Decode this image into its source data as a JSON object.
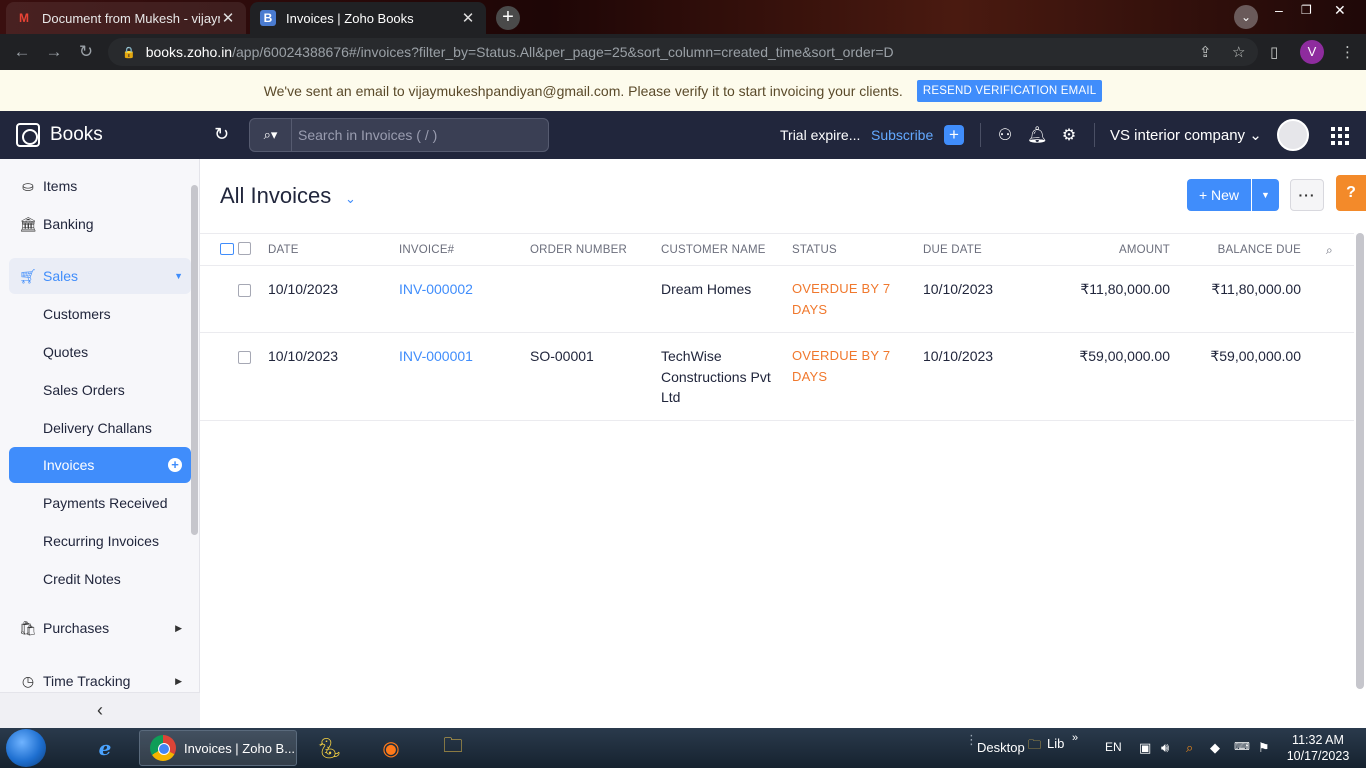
{
  "browser": {
    "tabs": [
      {
        "title": "Document from Mukesh - vijaym",
        "favicon": "M"
      },
      {
        "title": "Invoices | Zoho Books",
        "favicon": "B"
      }
    ],
    "url_host": "books.zoho.in",
    "url_rest": "/app/60024388676#/invoices?filter_by=Status.All&per_page=25&sort_column=created_time&sort_order=D",
    "profile_initial": "V"
  },
  "banner": {
    "message": "We've sent an email to vijaymukeshpandiyan@gmail.com. Please verify it to start invoicing your clients.",
    "button": "RESEND VERIFICATION EMAIL"
  },
  "header": {
    "brand": "Books",
    "search_placeholder": "Search in Invoices ( / )",
    "trial": "Trial expire...",
    "subscribe": "Subscribe",
    "org": "VS interior company"
  },
  "sidebar": {
    "items": [
      {
        "label": "Items"
      },
      {
        "label": "Banking"
      },
      {
        "label": "Sales"
      },
      {
        "label": "Customers"
      },
      {
        "label": "Quotes"
      },
      {
        "label": "Sales Orders"
      },
      {
        "label": "Delivery Challans"
      },
      {
        "label": "Invoices"
      },
      {
        "label": "Payments Received"
      },
      {
        "label": "Recurring Invoices"
      },
      {
        "label": "Credit Notes"
      },
      {
        "label": "Purchases"
      },
      {
        "label": "Time Tracking"
      }
    ]
  },
  "main": {
    "title": "All Invoices",
    "new_button": "New",
    "columns": [
      "DATE",
      "INVOICE#",
      "ORDER NUMBER",
      "CUSTOMER NAME",
      "STATUS",
      "DUE DATE",
      "AMOUNT",
      "BALANCE DUE"
    ],
    "rows": [
      {
        "date": "10/10/2023",
        "invoice": "INV-000002",
        "order": "",
        "customer": "Dream Homes",
        "status": "OVERDUE BY 7 DAYS",
        "due": "10/10/2023",
        "amount": "₹11,80,000.00",
        "balance": "₹11,80,000.00"
      },
      {
        "date": "10/10/2023",
        "invoice": "INV-000001",
        "order": "SO-00001",
        "customer": "TechWise Constructions Pvt Ltd",
        "status": "OVERDUE BY 7 DAYS",
        "due": "10/10/2023",
        "amount": "₹59,00,000.00",
        "balance": "₹59,00,000.00"
      }
    ]
  },
  "taskbar": {
    "task_label": "Invoices | Zoho B...",
    "desktop": "Desktop",
    "lib": "Lib",
    "lang": "EN",
    "time": "11:32 AM",
    "date": "10/17/2023"
  },
  "colors": {
    "accent": "#408dfb",
    "header_bg": "#21263c",
    "overdue": "#f0782d",
    "help": "#f38a2a"
  }
}
